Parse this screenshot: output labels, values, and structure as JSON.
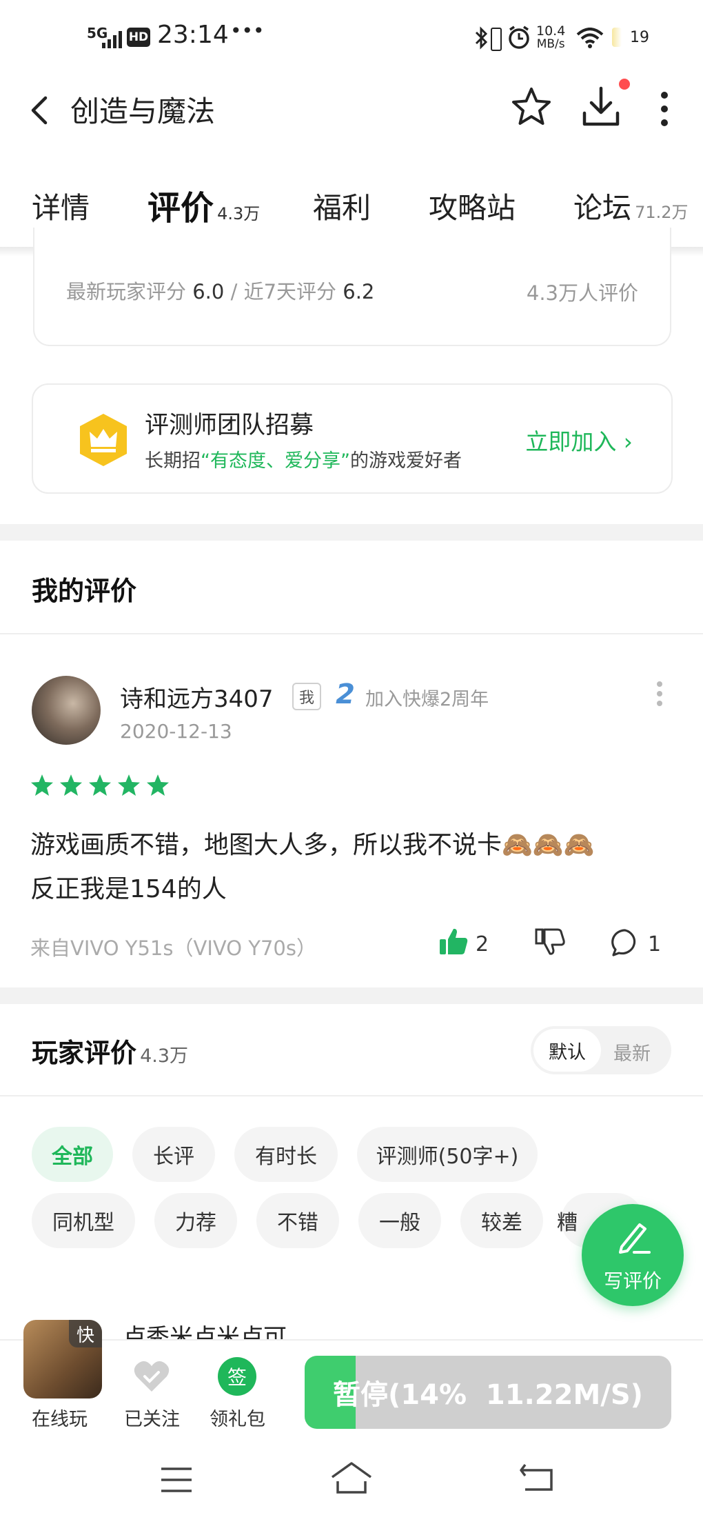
{
  "status_bar": {
    "network": "5G",
    "hd": "HD",
    "time": "23:14",
    "dots": "•••",
    "speed_value": "10.4",
    "speed_unit": "MB/s",
    "battery": "19"
  },
  "header": {
    "title": "创造与魔法",
    "notification_dot_color": "#ff4d4f"
  },
  "tabs": [
    {
      "label": "详情",
      "count": ""
    },
    {
      "label": "评价",
      "count": "4.3万",
      "active": true
    },
    {
      "label": "福利",
      "count": ""
    },
    {
      "label": "攻略站",
      "count": ""
    },
    {
      "label": "论坛",
      "count": "71.2万"
    }
  ],
  "rating_card": {
    "latest_label": "最新玩家评分",
    "latest_value": "6.0",
    "separator": "/",
    "recent_label": "近7天评分",
    "recent_value": "6.2",
    "total": "4.3万人评价"
  },
  "recruit": {
    "title": "评测师团队招募",
    "desc_prefix": "长期招",
    "desc_highlight": "“有态度、爱分享”",
    "desc_suffix": "的游戏爱好者",
    "action": "立即加入 ›"
  },
  "my_review": {
    "section_title": "我的评价",
    "username": "诗和远方3407",
    "me_badge": "我",
    "anniversary_num": "2",
    "anniversary_text": "加入快爆2周年",
    "date": "2020-12-13",
    "stars": 5,
    "text_line1": "游戏画质不错，地图大人多，所以我不说卡🙈🙈🙈",
    "text_line2": "反正我是154的人",
    "device": "来自VIVO Y51s（VIVO Y70s）",
    "likes": "2",
    "comments": "1"
  },
  "player_reviews": {
    "title": "玩家评价",
    "count": "4.3万",
    "sort_default": "默认",
    "sort_latest": "最新",
    "filters_row1": [
      "全部",
      "长评",
      "有时长",
      "评测师(50字+)"
    ],
    "filters_row2": [
      "同机型",
      "力荐",
      "不错",
      "一般",
      "较差",
      "糟"
    ],
    "write_label": "写评价",
    "next_review_partial": "卢秀米卢米卢可"
  },
  "bottom": {
    "app_badge": "快",
    "online_play": "在线玩",
    "followed": "已关注",
    "gift_icon": "签",
    "gift": "领礼包",
    "download_status": "暂停(14%  11.22M/S)",
    "download_progress": 0.14
  },
  "colors": {
    "accent": "#1fb75a",
    "star": "#22b563",
    "fab": "#2ec76a"
  }
}
